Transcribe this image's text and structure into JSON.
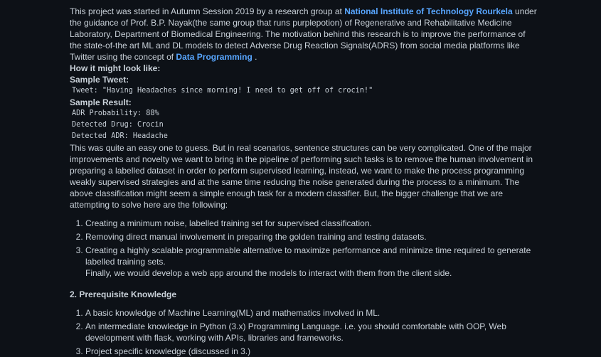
{
  "intro": {
    "part1": "This project was started in Autumn Session 2019 by a research group at ",
    "link1": "National Institute of Technology Rourkela",
    "part2": " under the guidance of Prof. B.P. Nayak(the same group that runs purplepotion) of Regenerative and Rehabilitative Medicine Laboratory, Department of Biomedical Engineering. The motivation behind this research is to improve the performance of the state-of-the art ML and DL models to detect Adverse Drug Reaction Signals(ADRS) from social media platforms like Twitter using the concept of ",
    "link2": "Data Programming",
    "part3": " ."
  },
  "how_label": "How it might look like:",
  "sample_tweet_label": "Sample Tweet:",
  "sample_tweet": "Tweet: \"Having Headaches since morning! I need to get off of crocin!\"",
  "sample_result_label": "Sample Result:",
  "sample_result": [
    "ADR Probability: 88%",
    "Detected Drug: Crocin",
    "Detected ADR: Headache"
  ],
  "paragraph2": "This was quite an easy one to guess. But in real scenarios, sentence structures can be very complicated. One of the major improvements and novelty we want to bring in the pipeline of performing such tasks is to remove the human involvement in preparing a labelled dataset in order to perform supervised learning, instead, we want to make the process programming weakly supervised strategies and at the same time reducing the noise generated during the process to a minimum. The above classification might seem a simple enough task for a modern classifier. But, the bigger challenge that we are attempting to solve here are the following:",
  "challenges": [
    "Creating a minimum noise, labelled training set for supervised classification.",
    "Removing direct manual involvement in preparing the golden training and testing datasets.",
    "Creating a highly scalable programmable alternative to maximize performance and minimize time required to generate labelled training sets."
  ],
  "finally_text": "Finally, we would develop a web app around the models to interact with them from the client side.",
  "section2_title": "2. Prerequisite Knowledge",
  "prereqs": [
    "A basic knowledge of Machine Learning(ML) and mathematics involved in ML.",
    "An intermediate knowledge in Python (3.x) Programming Language. i.e. you should comfortable with OOP, Web development with flask, working with APIs, libraries and frameworks.",
    "Project specific knowledge (discussed in 3.)"
  ]
}
